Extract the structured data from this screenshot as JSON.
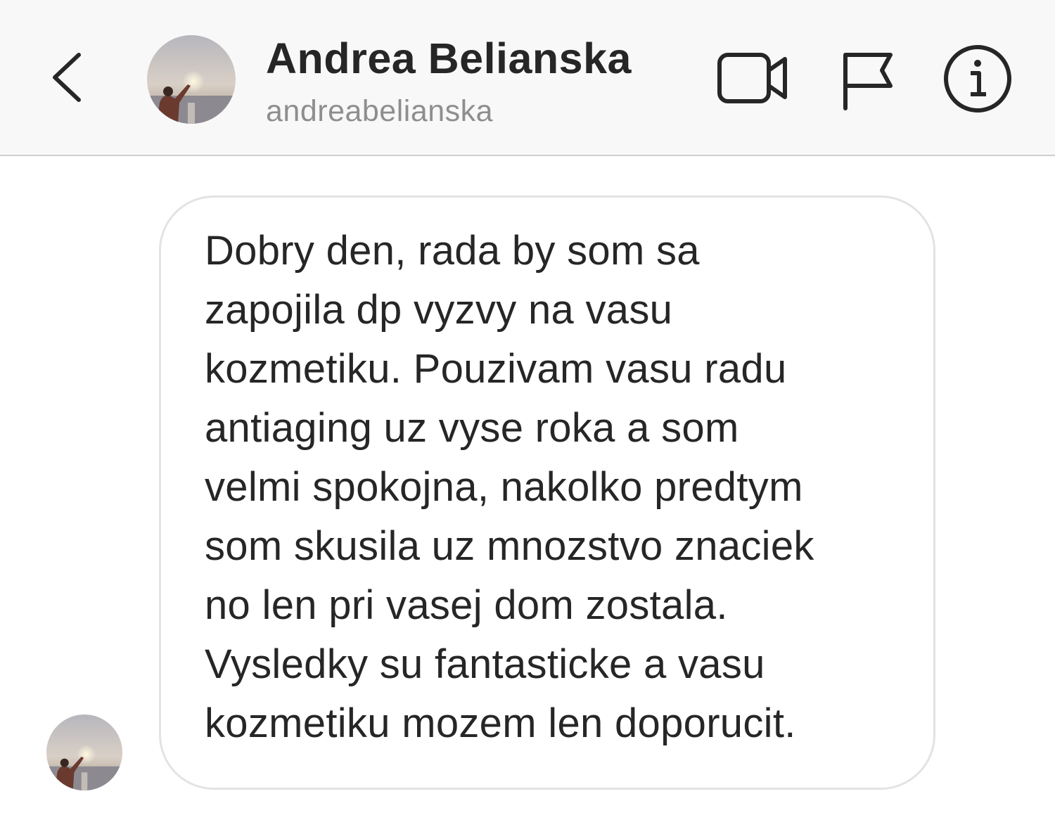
{
  "header": {
    "name": "Andrea Belianska",
    "username": "andreabelianska",
    "icons": {
      "back": "chevron-left-icon",
      "video": "video-camera-icon",
      "flag": "flag-icon",
      "info": "info-icon"
    }
  },
  "conversation": {
    "messages": [
      {
        "sender": "andreabelianska",
        "text": "Dobry den, rada by som sa\nzapojila dp vyzvy na vasu\nkozmetiku. Pouzivam vasu radu\nantiaging uz vyse roka a som\nvelmi spokojna, nakolko predtym\nsom skusila uz mnozstvo znaciek\nno len pri vasej dom zostala.\nVysledky su fantasticke a vasu\nkozmetiku mozem len doporucit."
      }
    ]
  },
  "colors": {
    "header_bg": "#f8f8f8",
    "text_primary": "#262626",
    "text_secondary": "#8e8e8e",
    "bubble_border": "#e3e3e3",
    "divider": "#cfcfcf"
  }
}
